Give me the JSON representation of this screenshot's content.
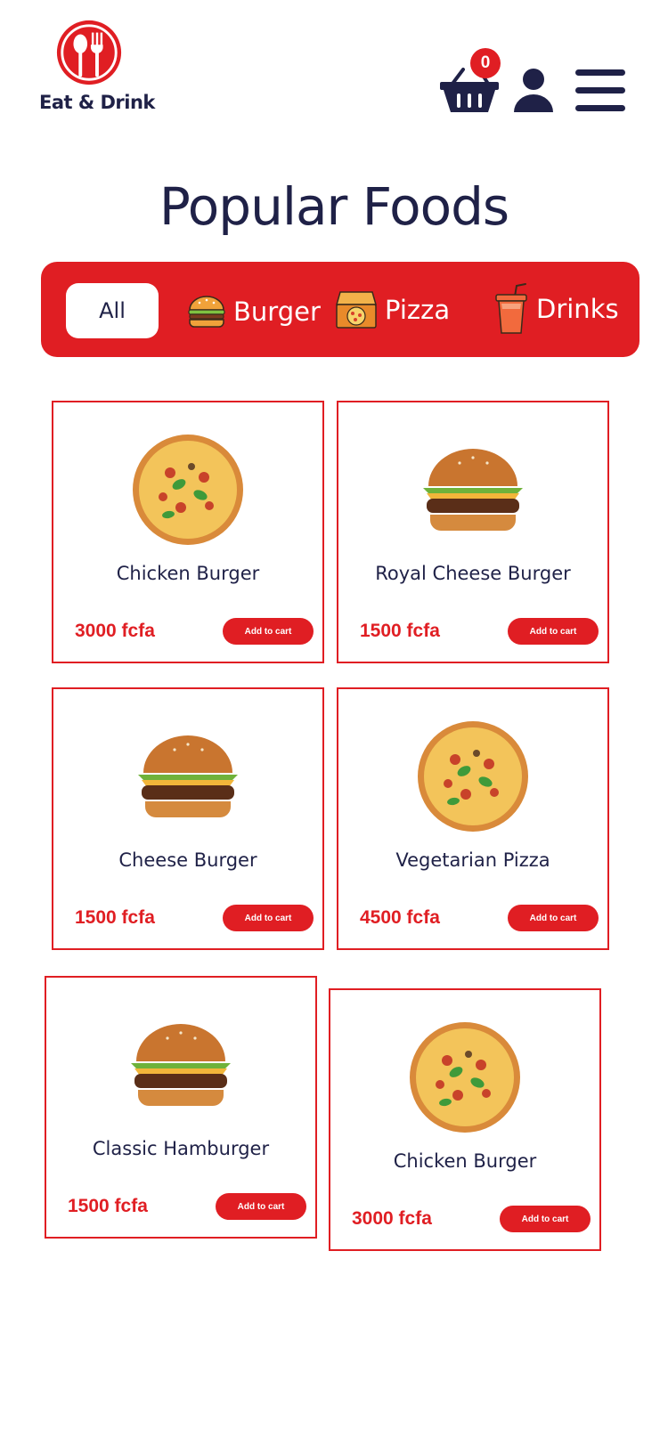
{
  "brand": {
    "name": "Eat & Drink",
    "logo_icon": "spoon-fork-icon",
    "accent": "#e01e23",
    "text_color": "#1f2147"
  },
  "header": {
    "cart_count": "0",
    "cart_icon": "basket-icon",
    "user_icon": "user-icon",
    "menu_icon": "hamburger-menu-icon"
  },
  "page": {
    "title": "Popular Foods"
  },
  "categories": [
    {
      "label": "All",
      "icon": "",
      "active": true
    },
    {
      "label": "Burger",
      "icon": "burger-icon",
      "active": false
    },
    {
      "label": "Pizza",
      "icon": "pizza-box-icon",
      "active": false
    },
    {
      "label": "Drinks",
      "icon": "drink-cup-icon",
      "active": false
    }
  ],
  "foods": [
    {
      "name": "Chicken Burger",
      "price": "3000 fcfa",
      "button": "Add to cart",
      "image": "pizza-image"
    },
    {
      "name": "Royal Cheese Burger",
      "price": "1500 fcfa",
      "button": "Add to cart",
      "image": "burger-image"
    },
    {
      "name": "Cheese Burger",
      "price": "1500 fcfa",
      "button": "Add to cart",
      "image": "burger-image"
    },
    {
      "name": "Vegetarian Pizza",
      "price": "4500 fcfa",
      "button": "Add to cart",
      "image": "pizza-image"
    },
    {
      "name": "Classic Hamburger",
      "price": "1500 fcfa",
      "button": "Add to cart",
      "image": "burger-image"
    },
    {
      "name": "Chicken Burger",
      "price": "3000 fcfa",
      "button": "Add to cart",
      "image": "pizza-image"
    }
  ]
}
